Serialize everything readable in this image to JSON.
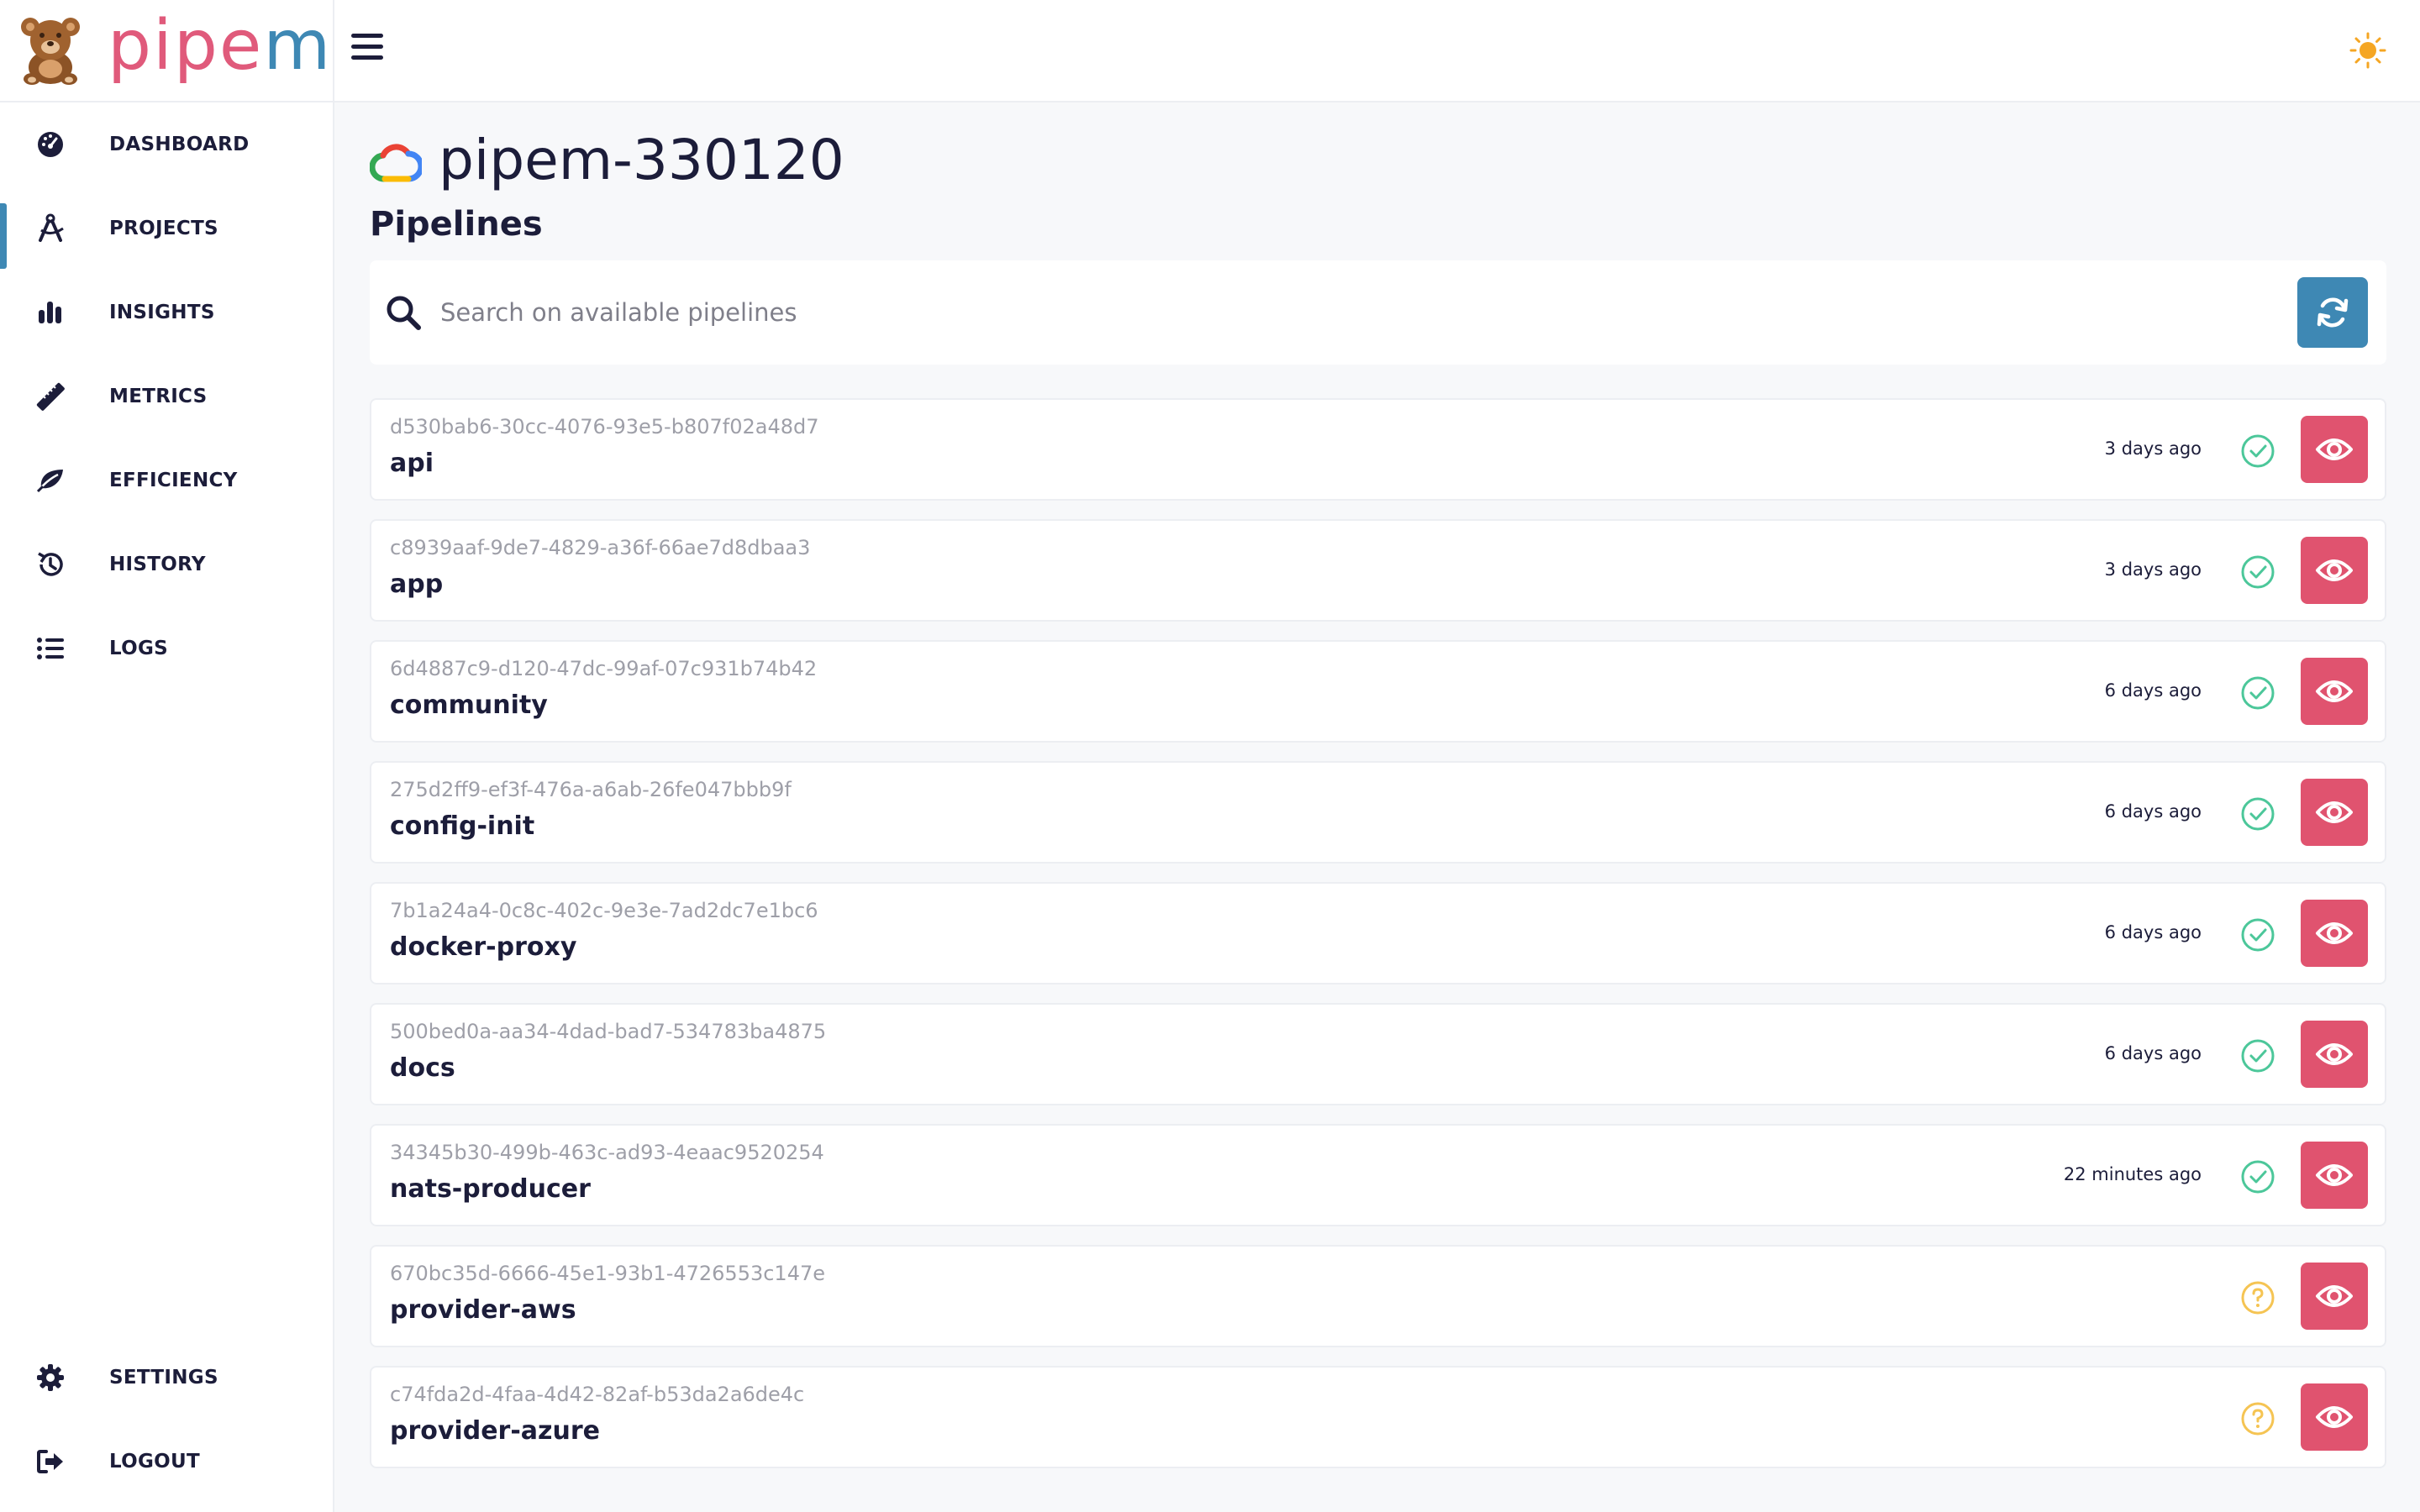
{
  "brand": {
    "name_prefix": "pipe",
    "name_suffix": "m"
  },
  "colors": {
    "accent": "#3e88b4",
    "brand_pink": "#e05a7b",
    "view_button": "#e0536f",
    "success": "#4cc79a",
    "unknown": "#f5c453",
    "sun": "#f5a623"
  },
  "sidebar": {
    "items": [
      {
        "label": "DASHBOARD",
        "icon": "gauge-icon"
      },
      {
        "label": "PROJECTS",
        "icon": "compass-icon",
        "active": true
      },
      {
        "label": "INSIGHTS",
        "icon": "bar-chart-icon"
      },
      {
        "label": "METRICS",
        "icon": "ruler-icon"
      },
      {
        "label": "EFFICIENCY",
        "icon": "leaf-icon"
      },
      {
        "label": "HISTORY",
        "icon": "history-icon"
      },
      {
        "label": "LOGS",
        "icon": "list-icon"
      }
    ],
    "bottom": [
      {
        "label": "SETTINGS",
        "icon": "gear-icon"
      },
      {
        "label": "LOGOUT",
        "icon": "logout-icon"
      }
    ]
  },
  "header": {
    "project_title": "pipem-330120",
    "section_title": "Pipelines"
  },
  "search": {
    "placeholder": "Search on available pipelines",
    "value": ""
  },
  "pipelines": [
    {
      "id": "d530bab6-30cc-4076-93e5-b807f02a48d7",
      "name": "api",
      "time": "3 days ago",
      "status": "success"
    },
    {
      "id": "c8939aaf-9de7-4829-a36f-66ae7d8dbaa3",
      "name": "app",
      "time": "3 days ago",
      "status": "success"
    },
    {
      "id": "6d4887c9-d120-47dc-99af-07c931b74b42",
      "name": "community",
      "time": "6 days ago",
      "status": "success"
    },
    {
      "id": "275d2ff9-ef3f-476a-a6ab-26fe047bbb9f",
      "name": "config-init",
      "time": "6 days ago",
      "status": "success"
    },
    {
      "id": "7b1a24a4-0c8c-402c-9e3e-7ad2dc7e1bc6",
      "name": "docker-proxy",
      "time": "6 days ago",
      "status": "success"
    },
    {
      "id": "500bed0a-aa34-4dad-bad7-534783ba4875",
      "name": "docs",
      "time": "6 days ago",
      "status": "success"
    },
    {
      "id": "34345b30-499b-463c-ad93-4eaac9520254",
      "name": "nats-producer",
      "time": "22 minutes ago",
      "status": "success"
    },
    {
      "id": "670bc35d-6666-45e1-93b1-4726553c147e",
      "name": "provider-aws",
      "time": "",
      "status": "unknown"
    },
    {
      "id": "c74fda2d-4faa-4d42-82af-b53da2a6de4c",
      "name": "provider-azure",
      "time": "",
      "status": "unknown"
    }
  ]
}
